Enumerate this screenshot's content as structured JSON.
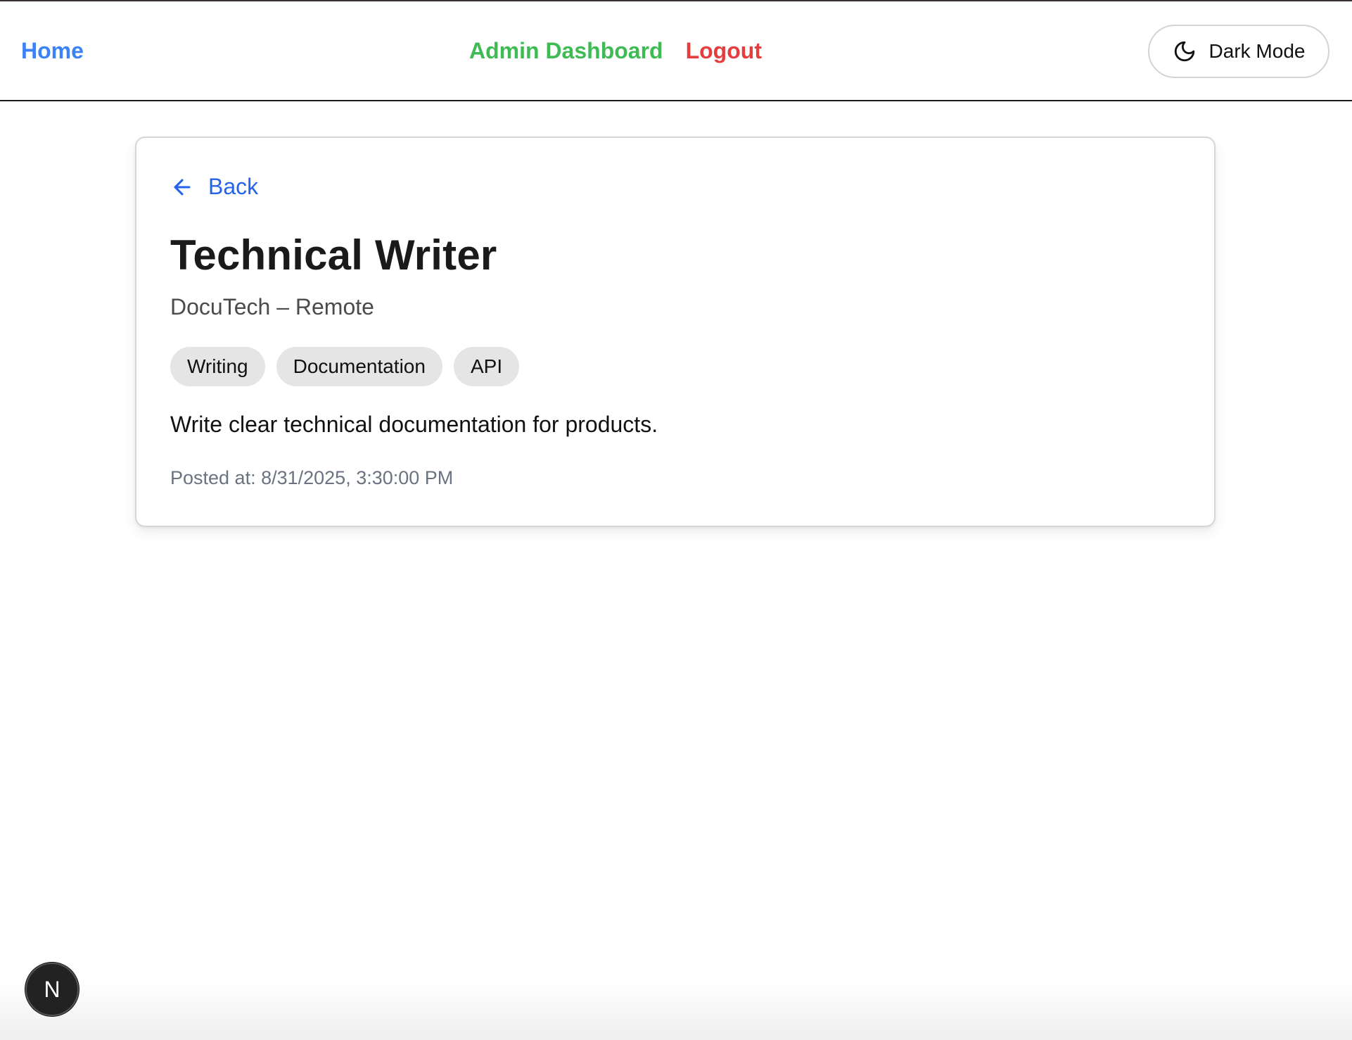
{
  "nav": {
    "home_label": "Home",
    "admin_label": "Admin Dashboard",
    "logout_label": "Logout",
    "dark_mode_label": "Dark Mode",
    "dark_mode_icon": "moon-icon"
  },
  "job": {
    "back_label": "Back",
    "back_icon": "arrow-left-icon",
    "title": "Technical Writer",
    "meta": "DocuTech – Remote",
    "tags": [
      "Writing",
      "Documentation",
      "API"
    ],
    "description": "Write clear technical documentation for products.",
    "posted_at": "Posted at: 8/31/2025, 3:30:00 PM"
  },
  "badge": {
    "letter": "N"
  },
  "colors": {
    "home": "#3b82f6",
    "admin": "#3fbb55",
    "logout": "#e53e3e",
    "back": "#2563eb",
    "tag_bg": "#e5e5e5"
  }
}
